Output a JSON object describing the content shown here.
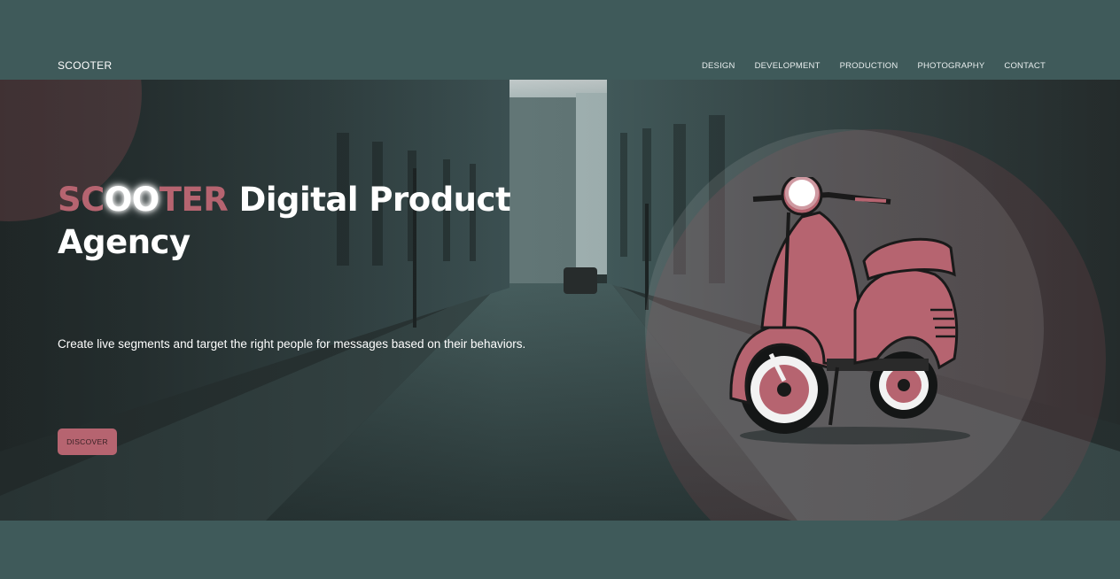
{
  "brand": "SCOOTER",
  "nav": {
    "items": [
      "DESIGN",
      "DEVELOPMENT",
      "PRODUCTION",
      "PHOTOGRAPHY",
      "CONTACT"
    ]
  },
  "hero": {
    "headline_accent_part1": "SC",
    "headline_accent_glow": "OO",
    "headline_accent_part2": "TER",
    "headline_rest_line1": " Digital Product",
    "headline_line2": "Agency",
    "subtitle": "Create live segments and target the right people for messages based on their behaviors.",
    "cta_label": "DISCOVER"
  },
  "colors": {
    "background": "#3f5a5a",
    "accent": "#b66470",
    "text": "#ffffff"
  },
  "icons": {
    "hero_illustration": "scooter-illustration"
  }
}
